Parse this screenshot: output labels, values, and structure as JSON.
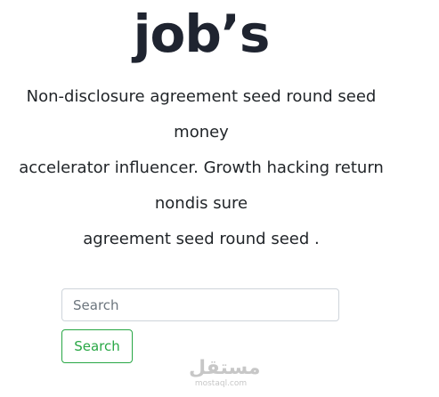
{
  "header": {
    "title": "job’s"
  },
  "description": {
    "lines": [
      "Non-disclosure agreement seed round seed",
      "money",
      "accelerator influencer. Growth hacking return",
      "nondis sure",
      "agreement seed round seed ."
    ]
  },
  "search": {
    "placeholder": "Search",
    "button_label": "Search",
    "accent_color": "#28a745"
  },
  "watermark": {
    "arabic": "مستقل",
    "latin": "mostaql.com"
  }
}
